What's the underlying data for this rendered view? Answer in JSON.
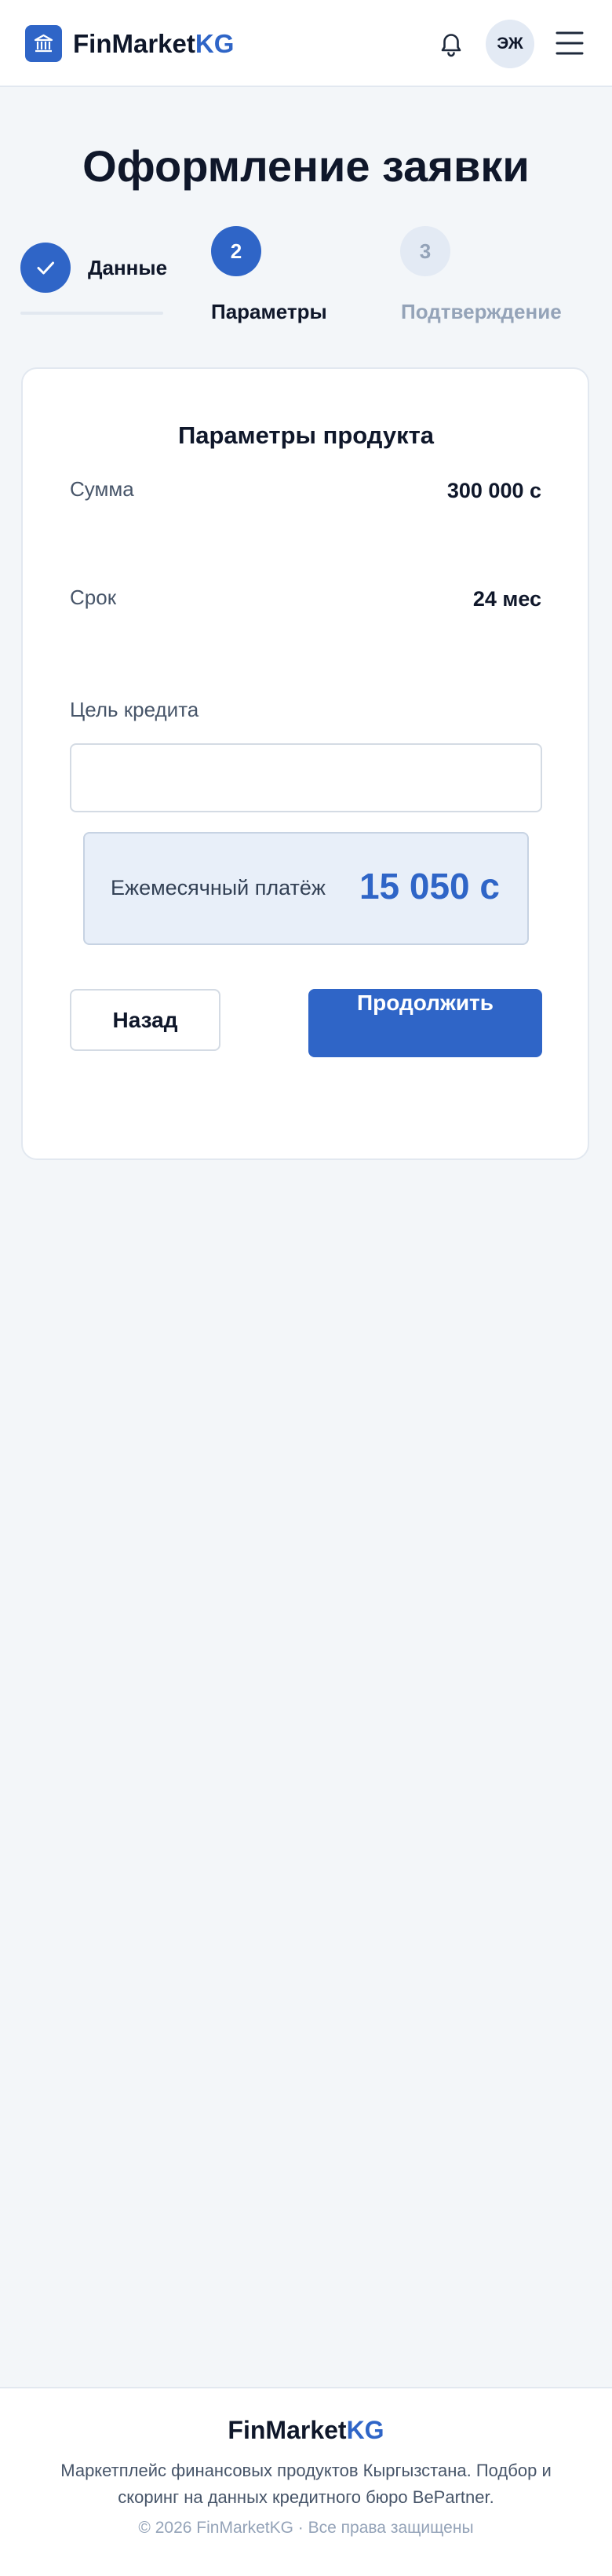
{
  "header": {
    "brand_main": "FinMarket",
    "brand_accent": "KG",
    "avatar_initials": "ЭЖ",
    "icons": [
      "bank-icon",
      "bell-icon",
      "menu-icon"
    ]
  },
  "page": {
    "title": "Оформление заявки"
  },
  "stepper": {
    "steps": [
      {
        "number": "",
        "label": "Данные",
        "state": "done"
      },
      {
        "number": "2",
        "label": "Параметры",
        "state": "active"
      },
      {
        "number": "3",
        "label": "Подтверждение",
        "state": "pending"
      }
    ]
  },
  "form": {
    "title": "Параметры продукта",
    "amount_label": "Сумма",
    "amount_value": "300 000 с",
    "term_label": "Срок",
    "term_value": "24 мес",
    "purpose_label": "Цель кредита",
    "purpose_value": "",
    "payment_label": "Ежемесячный платёж",
    "payment_value": "15 050 с",
    "back_label": "Назад",
    "continue_label": "Продолжить"
  },
  "footer": {
    "brand_main": "FinMarket",
    "brand_accent": "KG",
    "description": "Маркетплейс финансовых продуктов Кыргызстана. Подбор и скоринг на данных кредитного бюро BePartner.",
    "copyright": "© 2026 FinMarketKG · Все права защищены"
  },
  "colors": {
    "accent": "#2f65c7",
    "background": "#f3f6f9",
    "text": "#0f172a",
    "muted": "#94a3b8"
  }
}
